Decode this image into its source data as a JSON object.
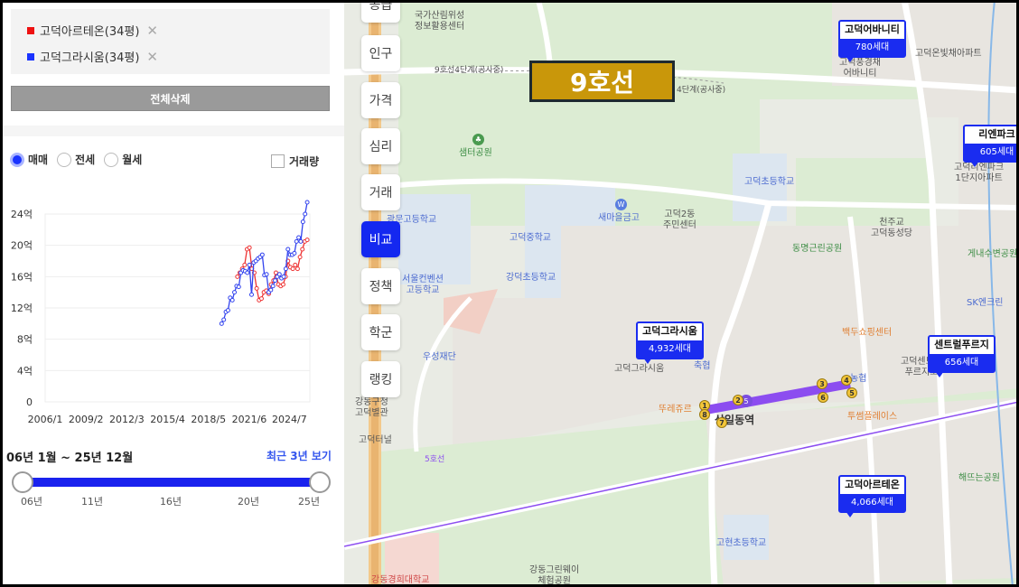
{
  "selected": [
    {
      "label": "고덕아르테온(34평)",
      "color": "#ee1111"
    },
    {
      "label": "고덕그라시움(34평)",
      "color": "#1a33ff"
    }
  ],
  "delete_all": "전체삭제",
  "trade_types": [
    {
      "label": "매매",
      "checked": true
    },
    {
      "label": "전세",
      "checked": false
    },
    {
      "label": "월세",
      "checked": false
    }
  ],
  "volume_label": "거래량",
  "volume_checked": false,
  "chart_data": {
    "type": "line",
    "title": "",
    "ylabel": "",
    "xlabel": "",
    "y_ticks": [
      "0",
      "4억",
      "8억",
      "12억",
      "16억",
      "20억",
      "24억"
    ],
    "ylim": [
      0,
      24
    ],
    "x_ticks": [
      "2006/1",
      "2009/2",
      "2012/3",
      "2015/4",
      "2018/5",
      "2021/6",
      "2024/7"
    ],
    "xlim": [
      2006.0,
      2026.1
    ],
    "grid": true,
    "series": [
      {
        "name": "고덕아르테온(34평)",
        "color": "#ee3333",
        "start": 2020.6,
        "end": 2025.9,
        "values": [
          16,
          16.5,
          17,
          17.5,
          19.5,
          19.7,
          17,
          16.5,
          14.5,
          13,
          13.2,
          14,
          14.2,
          13.8,
          15,
          15.5,
          16.5,
          15,
          14.8,
          15,
          16,
          18,
          17.2,
          17,
          17.5,
          17,
          18.5,
          19.5,
          20.5,
          20.7
        ]
      },
      {
        "name": "고덕그라시움(34평)",
        "color": "#3344ee",
        "start": 2019.4,
        "end": 2025.9,
        "values": [
          10,
          10.5,
          11.5,
          11.7,
          13.3,
          13,
          14,
          14.8,
          14.7,
          16.5,
          16.8,
          16.7,
          16.5,
          17.5,
          13.7,
          17.8,
          18,
          18.3,
          18.5,
          18.8,
          16.2,
          16.3,
          14,
          14.3,
          14.8,
          15.5,
          16,
          16.3,
          15.8,
          16,
          17,
          19.5,
          18.8,
          18.8,
          19,
          20.5,
          21,
          20.5,
          23,
          24,
          25.5
        ]
      }
    ]
  },
  "range": {
    "title": "06년 1월 ~ 25년 12월",
    "recent": "최근 3년 보기",
    "ticks": [
      "06년",
      "11년",
      "16년",
      "20년",
      "25년"
    ],
    "start_fraction": 0,
    "end_fraction": 1
  },
  "map": {
    "nav": [
      "공급",
      "인구",
      "가격",
      "심리",
      "거래",
      "비교",
      "정책",
      "학군",
      "랭킹"
    ],
    "active_nav": "비교",
    "banner": "9호선",
    "markers": [
      {
        "name": "고덕어바니티",
        "count": "780세대"
      },
      {
        "name": "리엔파크",
        "count": "605세대"
      },
      {
        "name": "고덕그라시움",
        "count": "4,932세대"
      },
      {
        "name": "센트럴푸르지",
        "count": "656세대"
      },
      {
        "name": "고덕아르테온",
        "count": "4,066세대"
      }
    ],
    "labels": {
      "l1": "국가산림위성\n정보활용센터",
      "l2": "9호선4단계(공사중)",
      "l3": "4단계(공사중)",
      "l4": "샘터공원",
      "l5": "광문고등학교",
      "l6": "고덕중학교",
      "l7": "새마을금고",
      "l8": "고덕2동\n주민센터",
      "l9": "서울컨벤션\n고등학교",
      "l10": "강덕초등학교",
      "l11": "우성재단",
      "l12": "고덕그라시움",
      "l13": "축협",
      "l14": "뚜레쥬르",
      "l15": "상일동역",
      "l16": "농협",
      "l17": "투썸플레이스",
      "l18": "백두쇼핑센터",
      "l19": "고덕초등학교",
      "l20": "동명근린공원",
      "l21": "천주교\n고덕동성당",
      "l22": "고덕온빛채아파트",
      "l23": "고덕풍경채\n어바니티",
      "l24": "고덕리엔파크\n1단지아파트",
      "l25": "게내수변공원",
      "l26": "SK엔크린",
      "l27": "고덕센트럴\n푸르지오",
      "l28": "해뜨는공원",
      "l29": "고현초등학교",
      "l30": "강동구청\n고덕별관",
      "l31": "고덕터널",
      "l32": "5호선",
      "l33": "강동그린웨이\n체험공원",
      "l34": "강동경희대학교"
    },
    "exits": [
      "1",
      "2",
      "3",
      "4",
      "5",
      "6",
      "7",
      "8"
    ],
    "station_line": "5"
  }
}
